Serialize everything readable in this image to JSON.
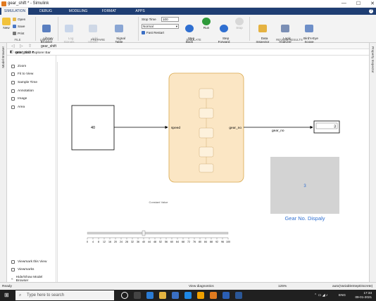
{
  "window": {
    "title": "gear_shift * - Simulink",
    "controls": [
      "—",
      "☐",
      "✕"
    ]
  },
  "tabs": [
    "SIMULATION",
    "DEBUG",
    "MODELING",
    "FORMAT",
    "APPS"
  ],
  "ribbon": {
    "new_label": "New",
    "open_label": "Open",
    "save_label": "Save",
    "print_label": "Print",
    "library_browser_label": "Library\nBrowser",
    "log_signals_label": "Log\nSignals",
    "add_viewer_label": "Add\nViewer",
    "signal_table_label": "Signal\nTable",
    "stop_time_label": "Stop Time",
    "stop_time_value": "100",
    "mode_value": "Normal",
    "fast_restart_label": "Fast Restart",
    "step_back_label": "Step\nBack",
    "run_label": "Run",
    "step_forward_label": "Step\nForward",
    "stop_label": "Stop",
    "data_inspector_label": "Data\nInspector",
    "logic_analyzer_label": "Logic\nAnalyzer",
    "birds_eye_label": "Bird's-Eye\nScope",
    "groups": [
      "FILE",
      "LIBRARY",
      "PREPARE",
      "SIMULATE",
      "REVIEW RESULTS"
    ]
  },
  "side_tabs": {
    "left": "Model Browser",
    "right": "Property Inspector"
  },
  "model_name": "gear_shift",
  "breadcrumb": "gear_shift",
  "explorer": {
    "hide_show_label": "Hide/Show Explorer Bar",
    "items": [
      "Zoom",
      "Fit to View",
      "Sample Time",
      "Annotation",
      "Image",
      "Area"
    ],
    "bottom_items": [
      "Viewmark this View",
      "Viewmarks",
      "Hide/Show Model Browser"
    ]
  },
  "diagram": {
    "constant_value": "40",
    "constant_caption": "Constant Value",
    "chart_input_port": "speed",
    "chart_output_port": "gear_no",
    "signal_label": "gear_no",
    "display_value": "3",
    "gauge_value": "3",
    "gauge_caption": "Gear No. Dispaly",
    "slider_ticks": [
      "0",
      "4",
      "8",
      "12",
      "16",
      "20",
      "24",
      "28",
      "32",
      "36",
      "40",
      "44",
      "48",
      "52",
      "56",
      "60",
      "64",
      "68",
      "72",
      "76",
      "80",
      "84",
      "88",
      "92",
      "96",
      "100"
    ],
    "slider_value": 40,
    "slider_min": 0,
    "slider_max": 100
  },
  "status": {
    "left": "Ready",
    "center": "View diagnostics",
    "zoom": "125%",
    "solver": "auto(VariableStepDiscrete)"
  },
  "taskbar": {
    "search_placeholder": "Type here to search",
    "tray_lang": "ENG",
    "time": "17:33",
    "date": "09-01-2021"
  },
  "colors": {
    "tab_bar": "#1f3e73",
    "chart_fill": "#fbe6c4",
    "chart_border": "#d9a84c",
    "gauge_fill": "#d3d3d3",
    "gauge_text": "#2f6fd1",
    "run_green": "#2e9a3a"
  }
}
